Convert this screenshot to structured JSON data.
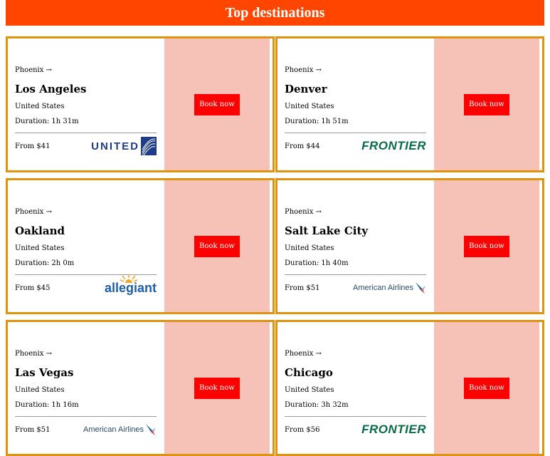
{
  "page": {
    "title": "Top destinations"
  },
  "book_label": "Book now",
  "cards": [
    {
      "origin": "Phoenix →",
      "city": "Los Angeles",
      "country": "United States",
      "duration": "Duration: 1h 31m",
      "price": "From $41",
      "logo": "UNITED",
      "logo_kind": "united"
    },
    {
      "origin": "Phoenix →",
      "city": "Denver",
      "country": "United States",
      "duration": "Duration: 1h 51m",
      "price": "From $44",
      "logo": "FRONTIER",
      "logo_kind": "frontier"
    },
    {
      "origin": "Phoenix →",
      "city": "Oakland",
      "country": "United States",
      "duration": "Duration: 2h 0m",
      "price": "From $45",
      "logo": "allegiant",
      "logo_kind": "allegiant"
    },
    {
      "origin": "Phoenix →",
      "city": "Salt Lake City",
      "country": "United States",
      "duration": "Duration: 1h 40m",
      "price": "From $51",
      "logo": "American Airlines",
      "logo_kind": "american"
    },
    {
      "origin": "Phoenix →",
      "city": "Las Vegas",
      "country": "United States",
      "duration": "Duration: 1h 16m",
      "price": "From $51",
      "logo": "American Airlines",
      "logo_kind": "american"
    },
    {
      "origin": "Phoenix →",
      "city": "Chicago",
      "country": "United States",
      "duration": "Duration: 3h 32m",
      "price": "From $56",
      "logo": "FRONTIER",
      "logo_kind": "frontier"
    }
  ],
  "colors": {
    "header_bg": "#ff4500",
    "card_border": "#e0930f",
    "action_bg": "#f6c1b7",
    "button_bg": "#ff0000"
  }
}
